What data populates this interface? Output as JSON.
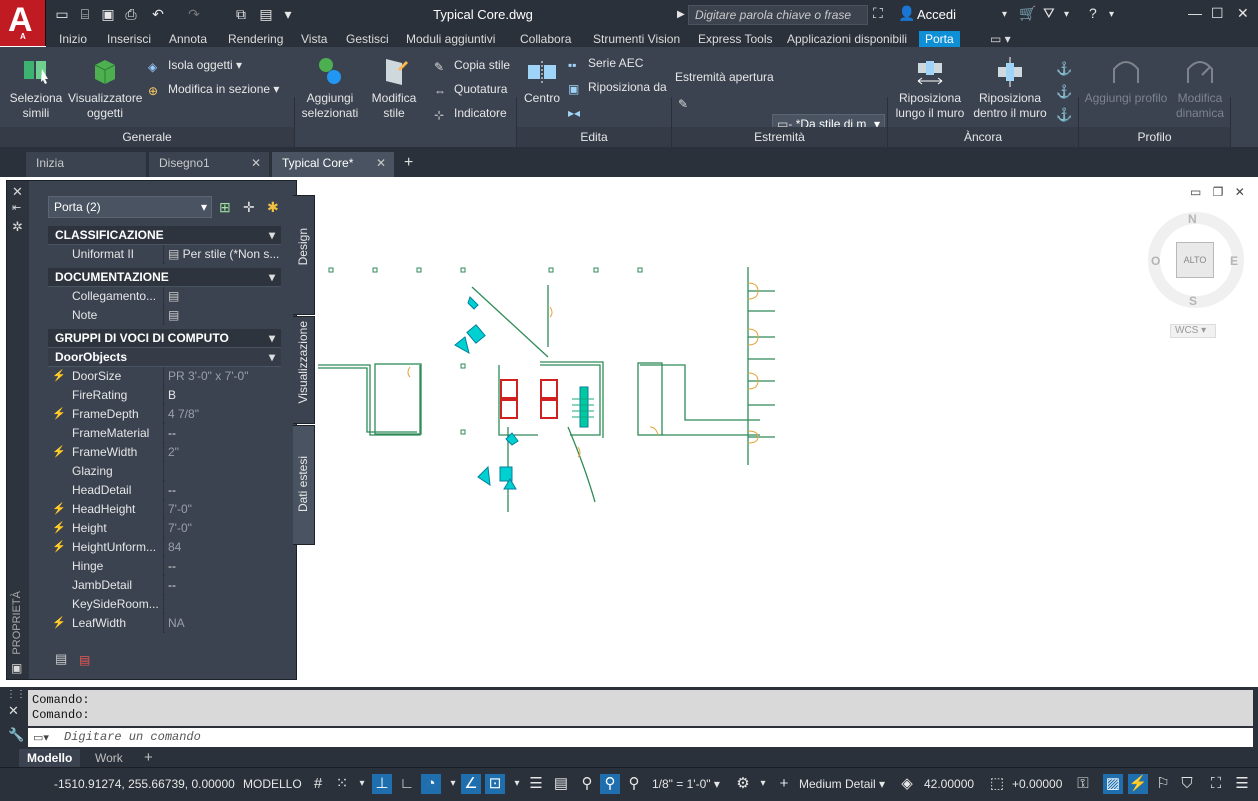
{
  "app": {
    "logo_letter": "A",
    "logo_sub": "A"
  },
  "title_bar": {
    "document_title": "Typical Core.dwg",
    "search_placeholder": "Digitare parola chiave o frase",
    "signin_label": "Accedi"
  },
  "ribbon_tabs": [
    "Inizio",
    "Inserisci",
    "Annota",
    "Rendering",
    "Vista",
    "Gestisci",
    "Moduli aggiuntivi",
    "Collabora",
    "Strumenti Vision",
    "Express Tools",
    "Applicazioni disponibili",
    "Porta"
  ],
  "ribbon_active_tab": "Porta",
  "ribbon": {
    "generale": {
      "panel_title": "Generale",
      "seleziona_simili": "Seleziona\nsimili",
      "visualizzatore": "Visualizzatore\noggetti",
      "isola_oggetti": "Isola oggetti",
      "modifica_sezione": "Modifica in sezione",
      "aggiungi_selezionati": "Aggiungi\nselezionati",
      "modifica_stile": "Modifica\nstile",
      "copia_stile": "Copia stile",
      "quotatura": "Quotatura",
      "indicatore": "Indicatore"
    },
    "edita": {
      "panel_title": "Edita",
      "centro": "Centro",
      "serie_aec": "Serie AEC",
      "riposiziona_da": "Riposiziona da"
    },
    "estremita": {
      "panel_title": "Estremità",
      "estremita_apertura": "Estremità apertura",
      "style_value": "*Da stile di m"
    },
    "ancora": {
      "panel_title": "Àncora",
      "riposiziona_lungo": "Riposiziona\nlungo il muro",
      "riposiziona_dentro": "Riposiziona\ndentro il muro"
    },
    "profilo": {
      "panel_title": "Profilo",
      "aggiungi_profilo": "Aggiungi profilo",
      "modifica_dinamica": "Modifica\ndinamica"
    }
  },
  "file_tabs": [
    {
      "label": "Inizia"
    },
    {
      "label": "Disegno1"
    },
    {
      "label": "Typical Core*"
    }
  ],
  "properties": {
    "palette_label": "PROPRIETÀ",
    "selection": "Porta (2)",
    "side_tabs": [
      "Design",
      "Visualizzazione",
      "Dati estesi"
    ],
    "sections": {
      "classificazione": "CLASSIFICAZIONE",
      "documentazione": "DOCUMENTAZIONE",
      "gruppi": "GRUPPI DI VOCI DI COMPUTO",
      "doorobjects": "DoorObjects"
    },
    "classificazione_rows": [
      {
        "key": "Uniformat II",
        "value": "Per stile (*Non s..."
      }
    ],
    "documentazione_rows": [
      {
        "key": "Collegamento...",
        "value": ""
      },
      {
        "key": "Note",
        "value": ""
      }
    ],
    "door_rows": [
      {
        "key": "DoorSize",
        "value": "PR 3'-0\" x 7'-0\"",
        "flag": true,
        "gray": true
      },
      {
        "key": "FireRating",
        "value": "B",
        "flag": false,
        "gray": false
      },
      {
        "key": "FrameDepth",
        "value": "4 7/8\"",
        "flag": true,
        "gray": true
      },
      {
        "key": "FrameMaterial",
        "value": "--",
        "flag": false,
        "gray": false
      },
      {
        "key": "FrameWidth",
        "value": "2\"",
        "flag": true,
        "gray": true
      },
      {
        "key": "Glazing",
        "value": "",
        "flag": false,
        "gray": false
      },
      {
        "key": "HeadDetail",
        "value": "--",
        "flag": false,
        "gray": false
      },
      {
        "key": "HeadHeight",
        "value": "7'-0\"",
        "flag": true,
        "gray": true
      },
      {
        "key": "Height",
        "value": "7'-0\"",
        "flag": true,
        "gray": true
      },
      {
        "key": "HeightUnform...",
        "value": "84",
        "flag": true,
        "gray": true
      },
      {
        "key": "Hinge",
        "value": "--",
        "flag": false,
        "gray": false
      },
      {
        "key": "JambDetail",
        "value": "--",
        "flag": false,
        "gray": false
      },
      {
        "key": "KeySideRoom...",
        "value": "",
        "flag": false,
        "gray": false
      },
      {
        "key": "LeafWidth",
        "value": "NA",
        "flag": true,
        "gray": true
      }
    ]
  },
  "viewcube": {
    "n": "N",
    "s": "S",
    "e": "E",
    "w": "O",
    "top": "ALTO",
    "ucs": "WCS"
  },
  "command": {
    "history": [
      "Comando:",
      "Comando:"
    ],
    "placeholder": "Digitare un comando"
  },
  "layout_tabs": [
    "Modello",
    "Work"
  ],
  "status": {
    "coords": "-1510.91274, 255.66739, 0.00000",
    "space": "MODELLO",
    "scale": "1/8\" = 1'-0\"",
    "detail": "Medium Detail",
    "elevation": "42.00000",
    "cut_plane": "+0.00000"
  },
  "colors": {
    "accent": "#0f8fd6",
    "titlebar": "#2b313a",
    "ribbon": "#3b4350",
    "brand": "#c01a22"
  }
}
